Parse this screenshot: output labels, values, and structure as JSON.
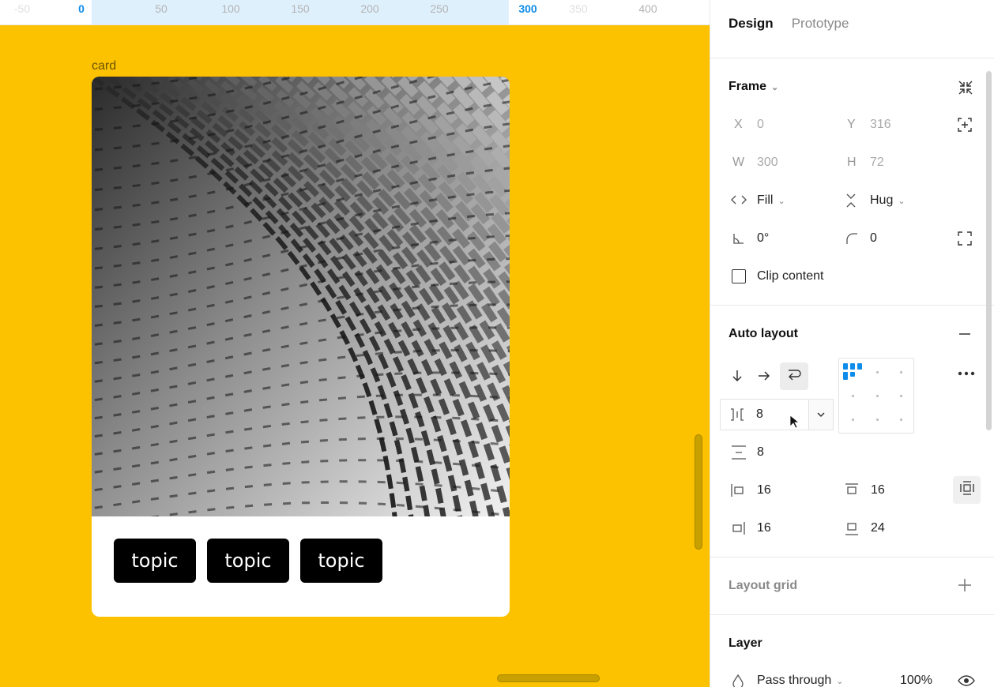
{
  "ruler": {
    "ticks": [
      {
        "label": "-50"
      },
      {
        "label": "0"
      },
      {
        "label": "50"
      },
      {
        "label": "100"
      },
      {
        "label": "150"
      },
      {
        "label": "200"
      },
      {
        "label": "250"
      },
      {
        "label": "300"
      },
      {
        "label": "350"
      },
      {
        "label": "400"
      }
    ]
  },
  "canvas": {
    "background": "#FCC200",
    "frame_label": "card",
    "tags": [
      "topic",
      "topic",
      "topic"
    ]
  },
  "panel": {
    "tabs": {
      "design": "Design",
      "prototype": "Prototype"
    },
    "frame": {
      "title": "Frame",
      "x_label": "X",
      "x_value": "0",
      "y_label": "Y",
      "y_value": "316",
      "w_label": "W",
      "w_value": "300",
      "h_label": "H",
      "h_value": "72",
      "width_mode": "Fill",
      "height_mode": "Hug",
      "rotation": "0°",
      "corner_radius": "0",
      "clip_content_label": "Clip content",
      "clip_content_checked": false
    },
    "auto_layout": {
      "title": "Auto layout",
      "direction_active": "wrap",
      "gap_horizontal": "8",
      "gap_vertical": "8",
      "padding_left": "16",
      "padding_top": "16",
      "padding_right": "16",
      "padding_bottom": "24",
      "alignment": "top-left"
    },
    "layout_grid": {
      "title": "Layout grid"
    },
    "layer": {
      "title": "Layer",
      "blend_mode": "Pass through",
      "opacity": "100%"
    },
    "accent_color": "#0D8CE9"
  }
}
